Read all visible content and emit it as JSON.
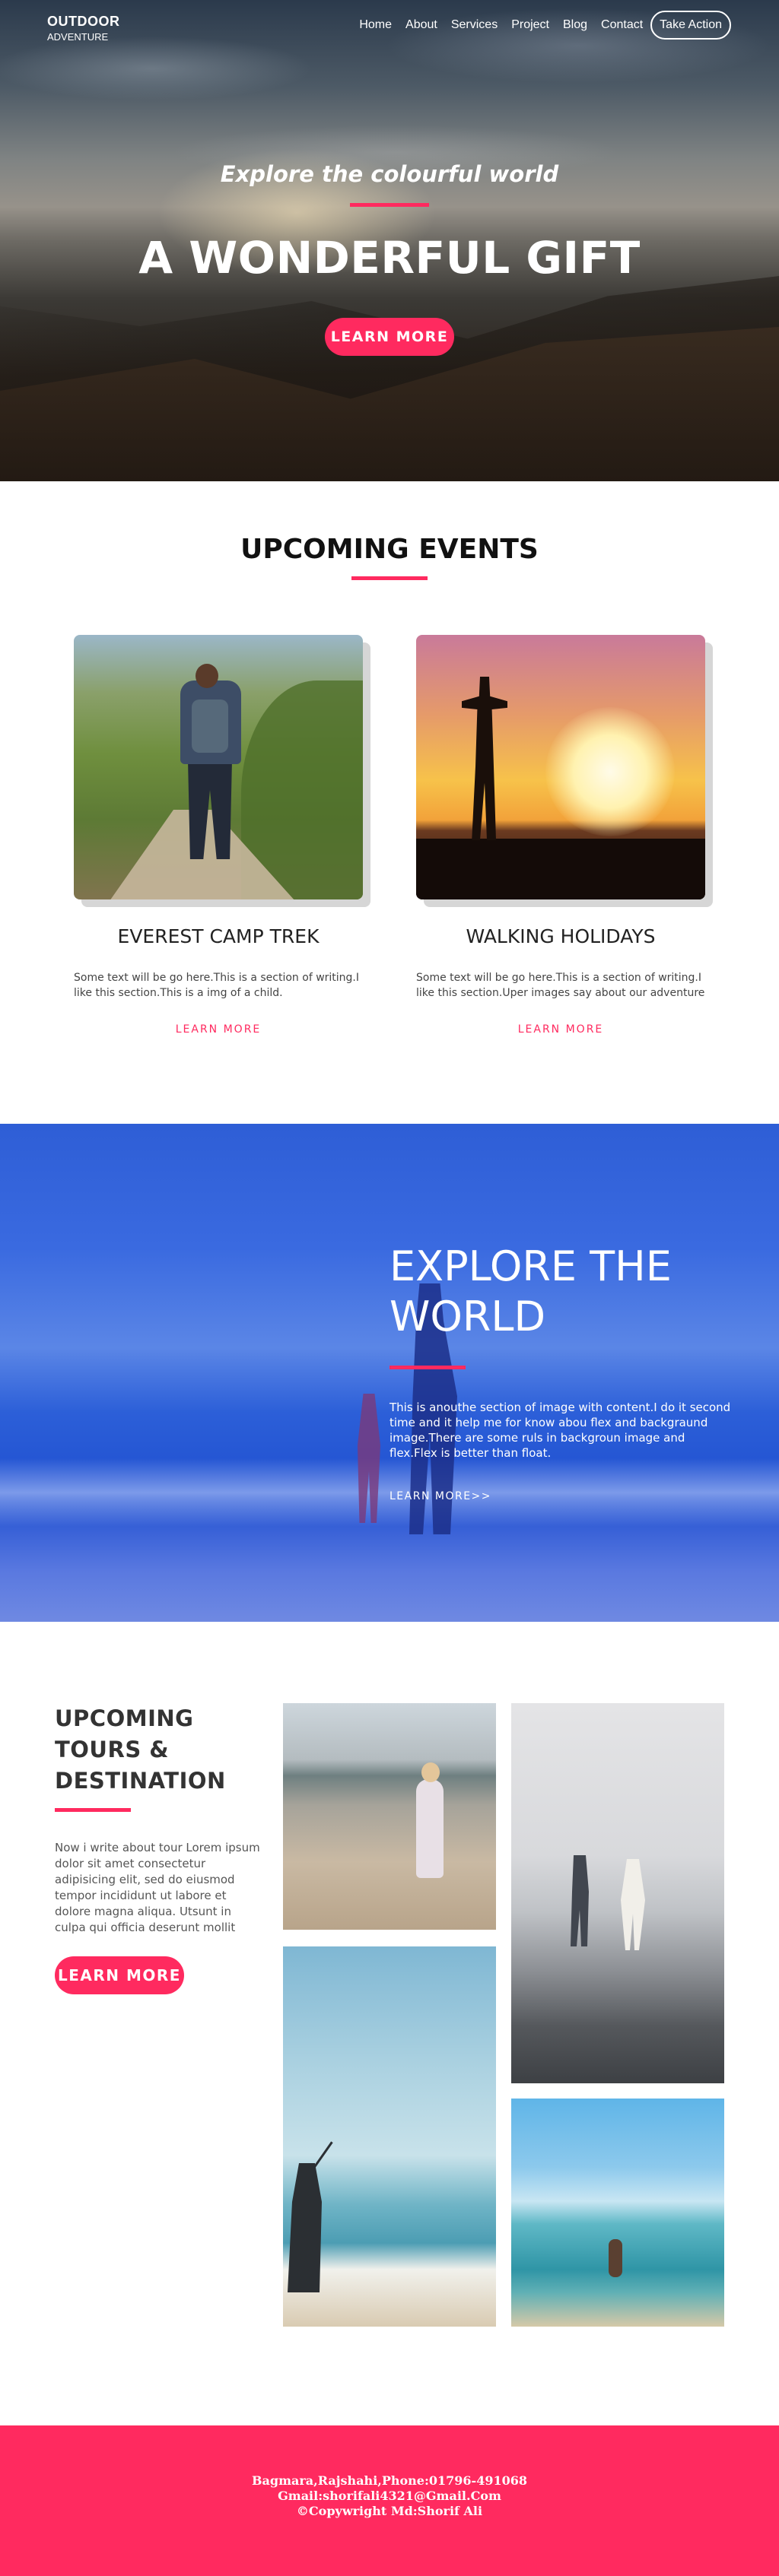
{
  "brand": {
    "line1": "OUTDOOR",
    "line2": "ADVENTURE"
  },
  "nav": {
    "items": [
      "Home",
      "About",
      "Services",
      "Project",
      "Blog",
      "Contact"
    ],
    "cta": "Take Action"
  },
  "hero": {
    "subtitle": "Explore the colourful world",
    "title": "A WONDERFUL GIFT",
    "button": "LEARN MORE"
  },
  "events": {
    "title": "UPCOMING EVENTS",
    "cards": [
      {
        "title": "EVEREST CAMP TREK",
        "text": "Some text will be go here.This is a section of writing.I like this section.This is a img of a child.",
        "link": "LEARN MORE"
      },
      {
        "title": "WALKING HOLIDAYS",
        "text": "Some text will be go here.This is a section of writing.I like this section.Uper images say about our adventure",
        "link": "LEARN MORE"
      }
    ]
  },
  "explore": {
    "title": "EXPLORE THE WORLD",
    "text": "This is anouthe section of image with content.I do it second time and it help me for know abou flex and backgraund image.There are some ruls in backgroun image and flex.Flex is better than float.",
    "link": "LEARN MORE>>"
  },
  "tours": {
    "title": "UPCOMING TOURS & DESTINATION",
    "text": "Now i write about tour Lorem ipsum dolor sit amet consectetur adipisicing elit, sed do eiusmod tempor incididunt ut labore et dolore magna aliqua. Utsunt in culpa qui officia deserunt mollit",
    "button": "LEARN MORE"
  },
  "footer": {
    "line1": "Bagmara,Rajshahi,Phone:01796-491068",
    "line2": "Gmail:shorifali4321@Gmail.Com",
    "line3": "©Copywright Md:Shorif Ali"
  },
  "colors": {
    "accent": "#ff2a5f",
    "explore_overlay": "#2e5ed6"
  }
}
